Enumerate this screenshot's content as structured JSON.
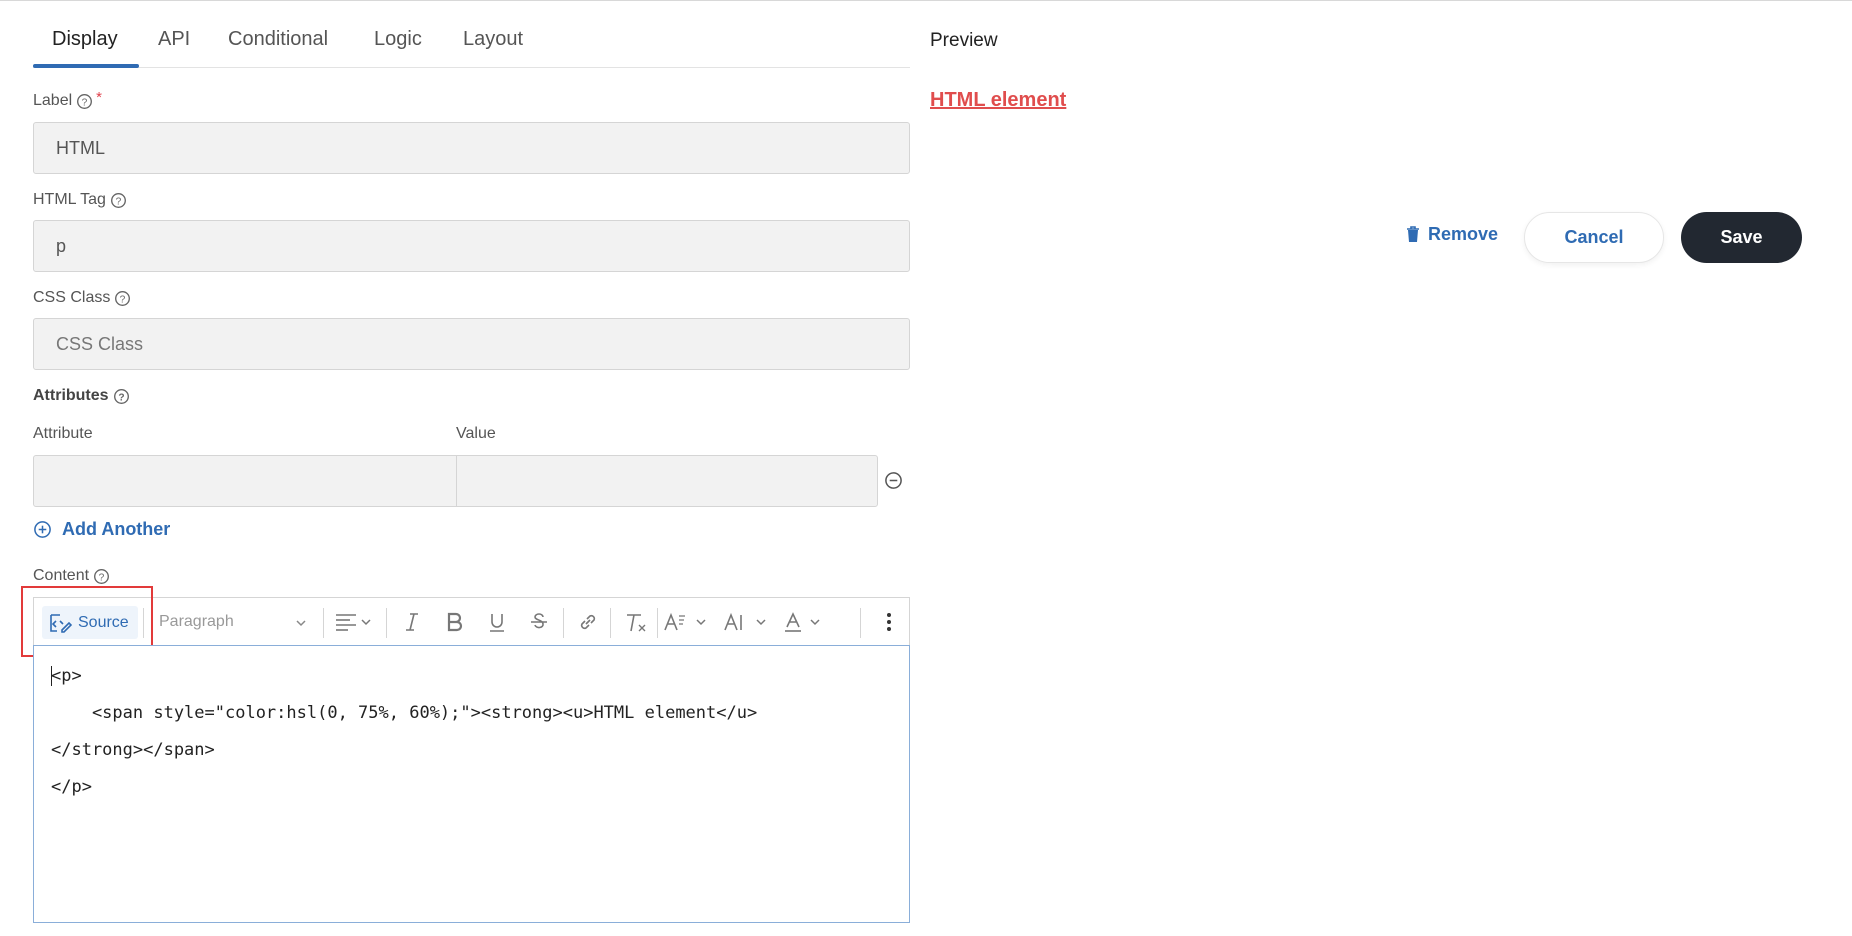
{
  "tabs": [
    {
      "label": "Display",
      "active": true
    },
    {
      "label": "API"
    },
    {
      "label": "Conditional"
    },
    {
      "label": "Logic"
    },
    {
      "label": "Layout"
    }
  ],
  "fields": {
    "label": {
      "title": "Label",
      "required_mark": "*",
      "value": "HTML"
    },
    "html_tag": {
      "title": "HTML Tag",
      "value": "p"
    },
    "css_class": {
      "title": "CSS Class",
      "placeholder": "CSS Class"
    },
    "attributes": {
      "title": "Attributes",
      "col_attribute": "Attribute",
      "col_value": "Value",
      "add_another": "Add Another"
    },
    "content": {
      "title": "Content"
    }
  },
  "editor": {
    "source_label": "Source",
    "paragraph_label": "Paragraph",
    "code_lines": [
      "<p>",
      "    <span style=\"color:hsl(0, 75%, 60%);\"><strong><u>HTML element</u>",
      "</strong></span>",
      "</p>"
    ]
  },
  "preview": {
    "title": "Preview",
    "content_text": "HTML element",
    "content_color": "#e04d4d"
  },
  "actions": {
    "remove": "Remove",
    "cancel": "Cancel",
    "save": "Save"
  },
  "icons": [
    "help-circle-icon",
    "minus-circle-icon",
    "plus-circle-icon",
    "source-code-icon",
    "chevron-down-icon",
    "align-left-icon",
    "italic-icon",
    "bold-icon",
    "underline-icon",
    "strikethrough-icon",
    "link-icon",
    "remove-format-icon",
    "font-size-icon",
    "font-family-icon",
    "font-color-icon",
    "more-vertical-icon",
    "trash-icon"
  ]
}
